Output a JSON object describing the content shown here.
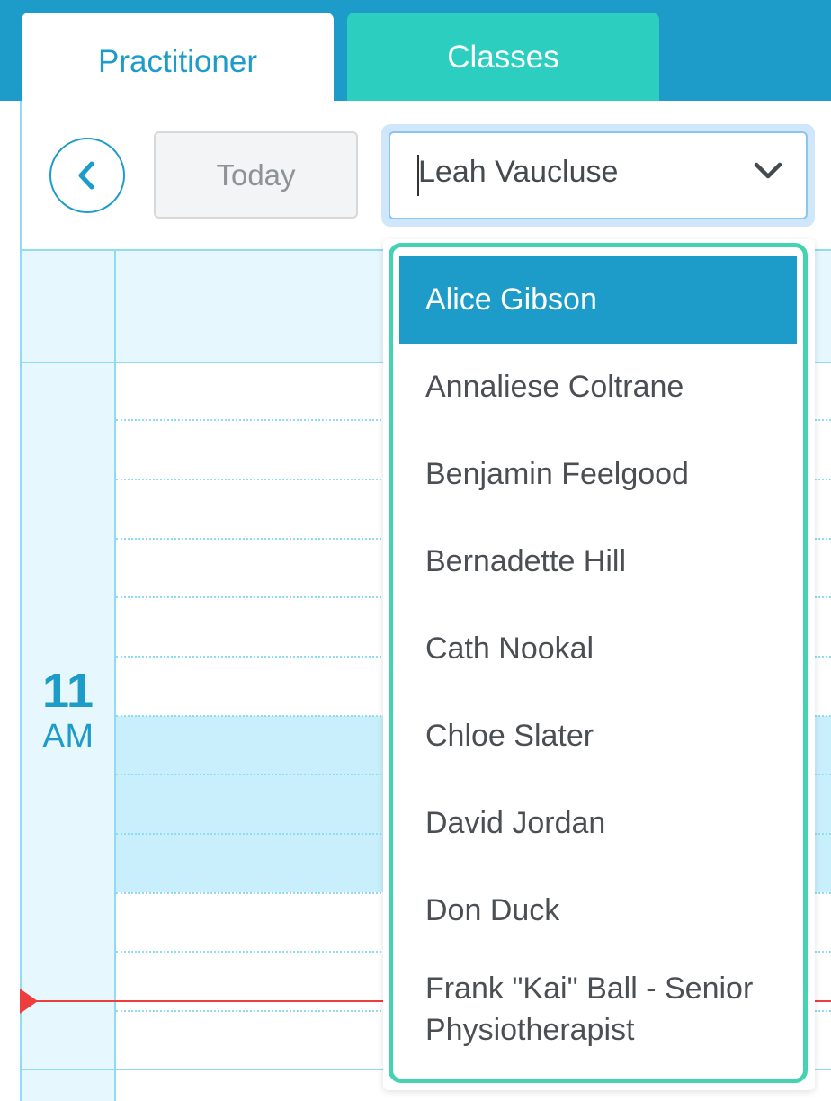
{
  "tabs": [
    {
      "label": "Practitioner",
      "active": true
    },
    {
      "label": "Classes",
      "active": false
    }
  ],
  "toolbar": {
    "back_icon": "chevron-left-icon",
    "today_label": "Today",
    "practitioner_select_value": "Leah Vaucluse",
    "dropdown_icon": "chevron-down-icon"
  },
  "calendar": {
    "hour_label": "11",
    "ampm_label": "AM"
  },
  "dropdown": {
    "options": [
      "Alice Gibson",
      "Annaliese Coltrane",
      "Benjamin Feelgood",
      "Bernadette Hill",
      "Cath Nookal",
      "Chloe Slater",
      "David Jordan",
      "Don Duck",
      "Frank \"Kai\" Ball - Senior Physiotherapist"
    ],
    "highlighted_option": "Alice Gibson"
  },
  "colors": {
    "brand_blue": "#1d9cc9",
    "classes_tab": "#2ccfbf",
    "dropdown_focus_border": "#43d3b0",
    "now_line": "#ee3d3d"
  }
}
